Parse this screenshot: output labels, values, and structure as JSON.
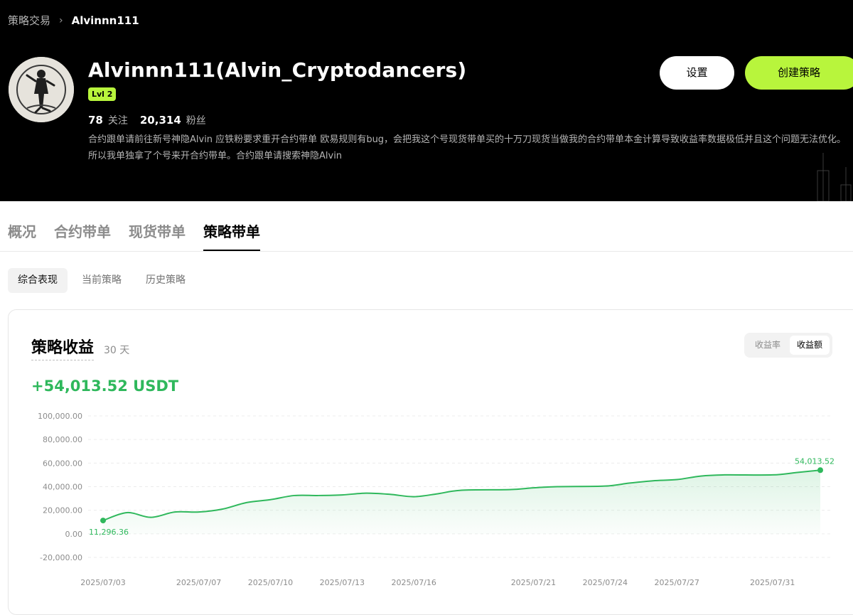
{
  "breadcrumb": {
    "parent": "策略交易",
    "separator": "›",
    "current": "Alvinnn111"
  },
  "profile": {
    "name": "Alvinnn111(Alvin_Cryptodancers)",
    "level": "Lvl 2",
    "following_count": "78",
    "following_label": "关注",
    "followers_count": "20,314",
    "followers_label": "粉丝",
    "bio": "合约跟单请前往新号神隐Alvin 应铁粉要求重开合约带单 欧易规则有bug，会把我这个号现货带单买的十万刀现货当做我的合约带单本金计算导致收益率数据极低并且这个问题无法优化。所以我单独拿了个号来开合约带单。合约跟单请搜索神隐Alvin",
    "avatar_icon": "avatar-image"
  },
  "actions": {
    "settings_label": "设置",
    "create_label": "创建策略"
  },
  "tabs": [
    {
      "label": "概况",
      "active": false
    },
    {
      "label": "合约带单",
      "active": false
    },
    {
      "label": "现货带单",
      "active": false
    },
    {
      "label": "策略带单",
      "active": true
    }
  ],
  "sub_tabs": [
    {
      "label": "综合表现",
      "active": true
    },
    {
      "label": "当前策略",
      "active": false
    },
    {
      "label": "历史策略",
      "active": false
    }
  ],
  "card": {
    "title": "策略收益",
    "period": "30 天",
    "total": "+54,013.52 USDT",
    "toggle": {
      "rate_label": "收益率",
      "amount_label": "收益额",
      "selected": "收益额"
    }
  },
  "colors": {
    "accent": "#b8f53c",
    "positive": "#2fb85c",
    "header_bg": "#000000"
  },
  "chart_data": {
    "type": "area",
    "ylim": [
      -20000,
      100000
    ],
    "y_ticks": [
      "100,000.00",
      "80,000.00",
      "60,000.00",
      "40,000.00",
      "20,000.00",
      "0.00",
      "-20,000.00"
    ],
    "y_tick_values": [
      100000,
      80000,
      60000,
      40000,
      20000,
      0,
      -20000
    ],
    "x_ticks": [
      "2025/07/03",
      "2025/07/07",
      "2025/07/10",
      "2025/07/13",
      "2025/07/16",
      "2025/07/21",
      "2025/07/24",
      "2025/07/27",
      "2025/07/31"
    ],
    "x_tick_dates": [
      "2025-07-03",
      "2025-07-07",
      "2025-07-10",
      "2025-07-13",
      "2025-07-16",
      "2025-07-21",
      "2025-07-24",
      "2025-07-27",
      "2025-07-31"
    ],
    "grid": true,
    "series": [
      {
        "points": [
          [
            "2025-07-03",
            11296.36
          ],
          [
            "2025-07-04",
            18000
          ],
          [
            "2025-07-05",
            14000
          ],
          [
            "2025-07-06",
            18500
          ],
          [
            "2025-07-07",
            18500
          ],
          [
            "2025-07-08",
            21000
          ],
          [
            "2025-07-09",
            26500
          ],
          [
            "2025-07-10",
            29000
          ],
          [
            "2025-07-11",
            32500
          ],
          [
            "2025-07-12",
            32500
          ],
          [
            "2025-07-13",
            33000
          ],
          [
            "2025-07-14",
            34500
          ],
          [
            "2025-07-15",
            33500
          ],
          [
            "2025-07-16",
            31500
          ],
          [
            "2025-07-17",
            34000
          ],
          [
            "2025-07-18",
            37000
          ],
          [
            "2025-07-20",
            37500
          ],
          [
            "2025-07-21",
            39000
          ],
          [
            "2025-07-22",
            40000
          ],
          [
            "2025-07-24",
            40500
          ],
          [
            "2025-07-25",
            43000
          ],
          [
            "2025-07-26",
            45000
          ],
          [
            "2025-07-27",
            46000
          ],
          [
            "2025-07-28",
            49000
          ],
          [
            "2025-07-29",
            50000
          ],
          [
            "2025-07-31",
            50000
          ],
          [
            "2025-08-01",
            52000
          ],
          [
            "2025-08-02",
            54013.52
          ]
        ]
      }
    ],
    "start_label": "11,296.36",
    "end_label": "54,013.52"
  }
}
